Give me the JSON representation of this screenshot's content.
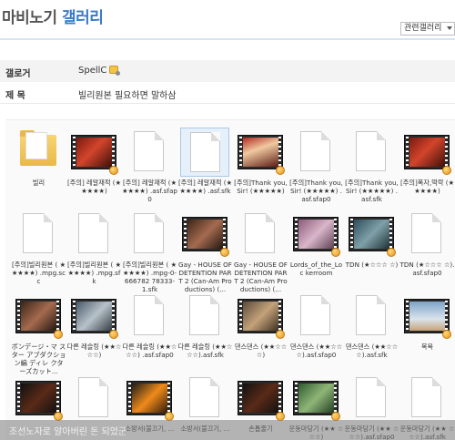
{
  "header": {
    "title_prefix": "마비노기",
    "title_suffix": "갤러리",
    "select_value": "관련갤러리"
  },
  "info": {
    "author_label": "갤로거",
    "author_value": "SpellC",
    "subject_label": "제 목",
    "subject_value": "빌리원본 필요하면 말하삼"
  },
  "colors": {
    "accent": "#3a7bc8",
    "header_line": "#d7e3f1",
    "selected_tile": "#e6f0fb"
  },
  "files": [
    {
      "caption": "빌리",
      "type": "folder"
    },
    {
      "caption": "[주의] 레알재적 (★★★★★)",
      "type": "video",
      "frame": "f-red"
    },
    {
      "caption": "[주의] 레알재적 (★★★★★) .asf.sfap0",
      "type": "doc"
    },
    {
      "caption": "[주의] 레알재적 (★★★★★) .asf.sfk",
      "type": "doc",
      "selected": true
    },
    {
      "caption": "[주의]Thank you, Sir! (★★★★★)",
      "type": "video",
      "frame": "f-stage"
    },
    {
      "caption": "[주의]Thank you, Sir! (★★★★★) .asf.sfap0",
      "type": "doc"
    },
    {
      "caption": "[주의]Thank you, Sir! (★★★★★) .asf.sfk",
      "type": "doc"
    },
    {
      "caption": "[주의]폭자,떡락 (★★★★★)",
      "type": "video",
      "frame": "f-red"
    },
    {
      "caption": "[주의]빌리원본 ( ★★★★★) .mpg.scc",
      "type": "doc"
    },
    {
      "caption": "[주의]빌리원본 ( ★★★★★) .mpg.sfk",
      "type": "doc"
    },
    {
      "caption": "[주의]빌리원본 ( ★★★★★) .mpg-0-666782 78333-1.sfk",
      "type": "doc"
    },
    {
      "caption": "Gay - HOUSE OF DETENTION PART 2 (Can-Am Productions) (...",
      "type": "video",
      "frame": "f-dark"
    },
    {
      "caption": "Gay - HOUSE OF DETENTION PART 2 (Can-Am Productions) (...",
      "type": "doc"
    },
    {
      "caption": "Lords_of_the_Loc kerroom",
      "type": "video",
      "frame": "f-pink"
    },
    {
      "caption": "TDN (★☆☆☆ ☆)",
      "type": "video",
      "frame": "f-teal"
    },
    {
      "caption": "TDN (★☆☆☆ ☆).asf.sfap0",
      "type": "doc"
    },
    {
      "caption": "ボンデージ・マ スター アブダクション編 ディレ クターズカット...",
      "type": "video",
      "frame": "f-dark"
    },
    {
      "caption": "다른 레슬링 (★★☆☆☆)",
      "type": "video",
      "frame": "f-room"
    },
    {
      "caption": "다른 레슬링 (★★☆☆☆) .asf.sfap0",
      "type": "doc"
    },
    {
      "caption": "다른 레슬링 (★★☆☆☆).asf.sfk",
      "type": "doc"
    },
    {
      "caption": "댄스댄스 (★★☆☆☆)",
      "type": "video",
      "frame": "f-gym"
    },
    {
      "caption": "댄스댄스 (★★☆☆☆).asf.sfap0",
      "type": "doc"
    },
    {
      "caption": "댄스댄스 (★★☆☆☆).asf.sfk",
      "type": "doc"
    },
    {
      "caption": "목욕",
      "type": "video",
      "frame": "f-sky"
    },
    {
      "caption": "",
      "type": "video",
      "frame": "f-night"
    },
    {
      "caption": "",
      "type": "doc"
    },
    {
      "caption": "소방서(불끄기, ...",
      "type": "video",
      "frame": "f-fire"
    },
    {
      "caption": "소방서(불끄기, ...",
      "type": "doc"
    },
    {
      "caption": "손톱줄기",
      "type": "video",
      "frame": "f-night"
    },
    {
      "caption": "운동마당기 (★★ ☆☆☆)",
      "type": "video",
      "frame": "f-green"
    },
    {
      "caption": "운동마당기 (★★ ☆☆☆).asf.sfap0",
      "type": "doc"
    },
    {
      "caption": "운동마당기 (★★ ☆☆☆).asf.sfk",
      "type": "doc"
    }
  ],
  "footer": {
    "overlay_text": "조선노자로 알아버린 돈 되었군"
  }
}
